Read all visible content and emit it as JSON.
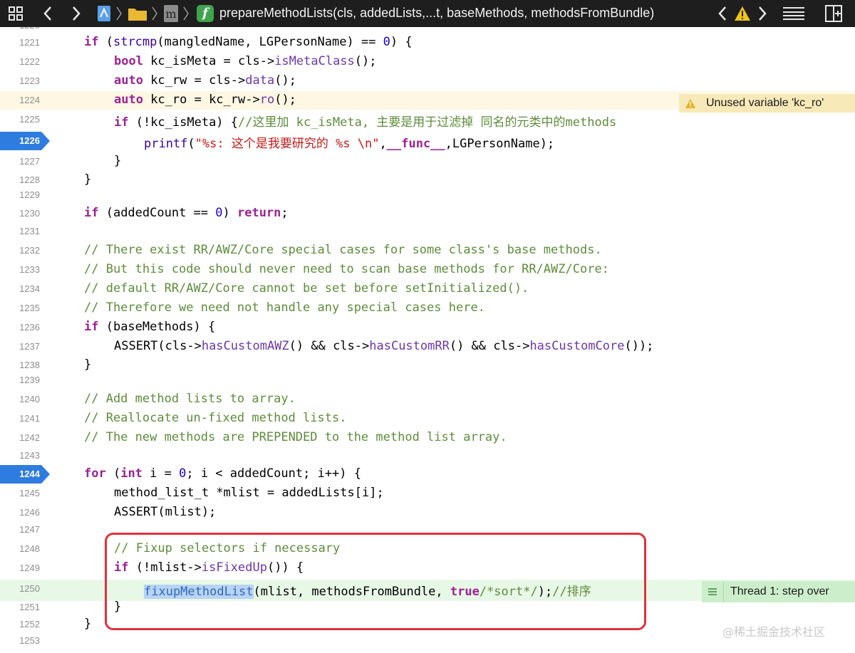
{
  "toolbar": {
    "breadcrumb_title": "prepareMethodLists(cls, addedLists,...t, baseMethods, methodsFromBundle)",
    "function_glyph": "f",
    "file_glyph": "m"
  },
  "top_partial_line": "1220",
  "lines": [
    {
      "n": "1221",
      "tokens": [
        [
          "kw",
          "if"
        ],
        [
          "",
          " ("
        ],
        [
          "fn2",
          "strcmp"
        ],
        [
          "",
          "(mangledName, LGPersonName) == "
        ],
        [
          "num",
          "0"
        ],
        [
          "",
          ") {"
        ]
      ]
    },
    {
      "n": "1222",
      "tokens": [
        [
          "kw",
          "bool"
        ],
        [
          "",
          " kc_isMeta = cls->"
        ],
        [
          "fn",
          "isMetaClass"
        ],
        [
          "",
          "();"
        ]
      ]
    },
    {
      "n": "1223",
      "tokens": [
        [
          "kw",
          "auto"
        ],
        [
          "",
          " kc_rw = cls->"
        ],
        [
          "fn",
          "data"
        ],
        [
          "",
          "();"
        ]
      ]
    },
    {
      "n": "1224",
      "tokens": [
        [
          "kw",
          "auto"
        ],
        [
          "",
          " kc_ro = kc_rw->"
        ],
        [
          "fn",
          "ro"
        ],
        [
          "",
          "();"
        ]
      ]
    },
    {
      "n": "1225",
      "tokens": [
        [
          "kw",
          "if"
        ],
        [
          "",
          " (!kc_isMeta) {"
        ],
        [
          "cm",
          "//这里加 kc_isMeta, 主要是用于过滤掉 同名的元类中的methods"
        ]
      ]
    },
    {
      "n": "1226",
      "tokens": [
        [
          "fn2",
          "printf"
        ],
        [
          "",
          "("
        ],
        [
          "str",
          "\"%s: 这个是我要研究的 %s \\n\""
        ],
        [
          "",
          ","
        ],
        [
          "kw",
          "__func__"
        ],
        [
          "",
          ",LGPersonName);"
        ]
      ]
    },
    {
      "n": "1227",
      "tokens": [
        [
          "",
          "}"
        ]
      ]
    },
    {
      "n": "1228",
      "tokens": [
        [
          "",
          "}"
        ]
      ]
    },
    {
      "n": "1229",
      "tokens": []
    },
    {
      "n": "1230",
      "tokens": [
        [
          "kw",
          "if"
        ],
        [
          "",
          " (addedCount == "
        ],
        [
          "num",
          "0"
        ],
        [
          "",
          ") "
        ],
        [
          "kw",
          "return"
        ],
        [
          "",
          ";"
        ]
      ]
    },
    {
      "n": "1231",
      "tokens": []
    },
    {
      "n": "1232",
      "tokens": [
        [
          "cm",
          "// There exist RR/AWZ/Core special cases for some class's base methods."
        ]
      ]
    },
    {
      "n": "1233",
      "tokens": [
        [
          "cm",
          "// But this code should never need to scan base methods for RR/AWZ/Core:"
        ]
      ]
    },
    {
      "n": "1234",
      "tokens": [
        [
          "cm",
          "// default RR/AWZ/Core cannot be set before setInitialized()."
        ]
      ]
    },
    {
      "n": "1235",
      "tokens": [
        [
          "cm",
          "// Therefore we need not handle any special cases here."
        ]
      ]
    },
    {
      "n": "1236",
      "tokens": [
        [
          "kw",
          "if"
        ],
        [
          "",
          " (baseMethods) {"
        ]
      ]
    },
    {
      "n": "1237",
      "tokens": [
        [
          "",
          "ASSERT(cls->"
        ],
        [
          "fn",
          "hasCustomAWZ"
        ],
        [
          "",
          "() && cls->"
        ],
        [
          "fn",
          "hasCustomRR"
        ],
        [
          "",
          "() && cls->"
        ],
        [
          "fn",
          "hasCustomCore"
        ],
        [
          "",
          "());"
        ]
      ]
    },
    {
      "n": "1238",
      "tokens": [
        [
          "",
          "}"
        ]
      ]
    },
    {
      "n": "1239",
      "tokens": []
    },
    {
      "n": "1240",
      "tokens": [
        [
          "cm",
          "// Add method lists to array."
        ]
      ]
    },
    {
      "n": "1241",
      "tokens": [
        [
          "cm",
          "// Reallocate un-fixed method lists."
        ]
      ]
    },
    {
      "n": "1242",
      "tokens": [
        [
          "cm",
          "// The new methods are PREPENDED to the method list array."
        ]
      ]
    },
    {
      "n": "1243",
      "tokens": []
    },
    {
      "n": "1244",
      "tokens": [
        [
          "kw",
          "for"
        ],
        [
          "",
          " ("
        ],
        [
          "kw",
          "int"
        ],
        [
          "",
          " i = "
        ],
        [
          "num",
          "0"
        ],
        [
          "",
          "; i < addedCount; i++) {"
        ]
      ]
    },
    {
      "n": "1245",
      "tokens": [
        [
          "",
          "method_list_t *mlist = addedLists[i];"
        ]
      ]
    },
    {
      "n": "1246",
      "tokens": [
        [
          "",
          "ASSERT(mlist);"
        ]
      ]
    },
    {
      "n": "1247",
      "tokens": []
    },
    {
      "n": "1248",
      "tokens": [
        [
          "cm",
          "// Fixup selectors if necessary"
        ]
      ]
    },
    {
      "n": "1249",
      "tokens": [
        [
          "kw",
          "if"
        ],
        [
          "",
          " (!mlist->"
        ],
        [
          "fn",
          "isFixedUp"
        ],
        [
          "",
          "()) {"
        ]
      ]
    },
    {
      "n": "1250",
      "tokens": [
        [
          "sel",
          "fixupMethodList"
        ],
        [
          "",
          "(mlist, methodsFromBundle, "
        ],
        [
          "kw",
          "true"
        ],
        [
          "cm",
          "/*sort*/"
        ],
        [
          "",
          ");"
        ],
        [
          "cm",
          "//排序"
        ]
      ]
    },
    {
      "n": "1251",
      "tokens": [
        [
          "",
          "}"
        ]
      ]
    },
    {
      "n": "1252",
      "tokens": [
        [
          "",
          "}"
        ]
      ]
    },
    {
      "n": "1253",
      "tokens": []
    }
  ],
  "annotations": {
    "warning_text": "Unused variable 'kc_ro'",
    "thread_text": "Thread 1: step over"
  },
  "watermark": "@稀土掘金技术社区",
  "colors": {
    "breakpoint": "#2f7ce0",
    "warning_row": "#fdf7e3",
    "warning_badge": "#f8e9b8",
    "current_row": "#e8f8e7",
    "thread_badge": "#cdeecb",
    "highlight_box": "#e0313c"
  }
}
